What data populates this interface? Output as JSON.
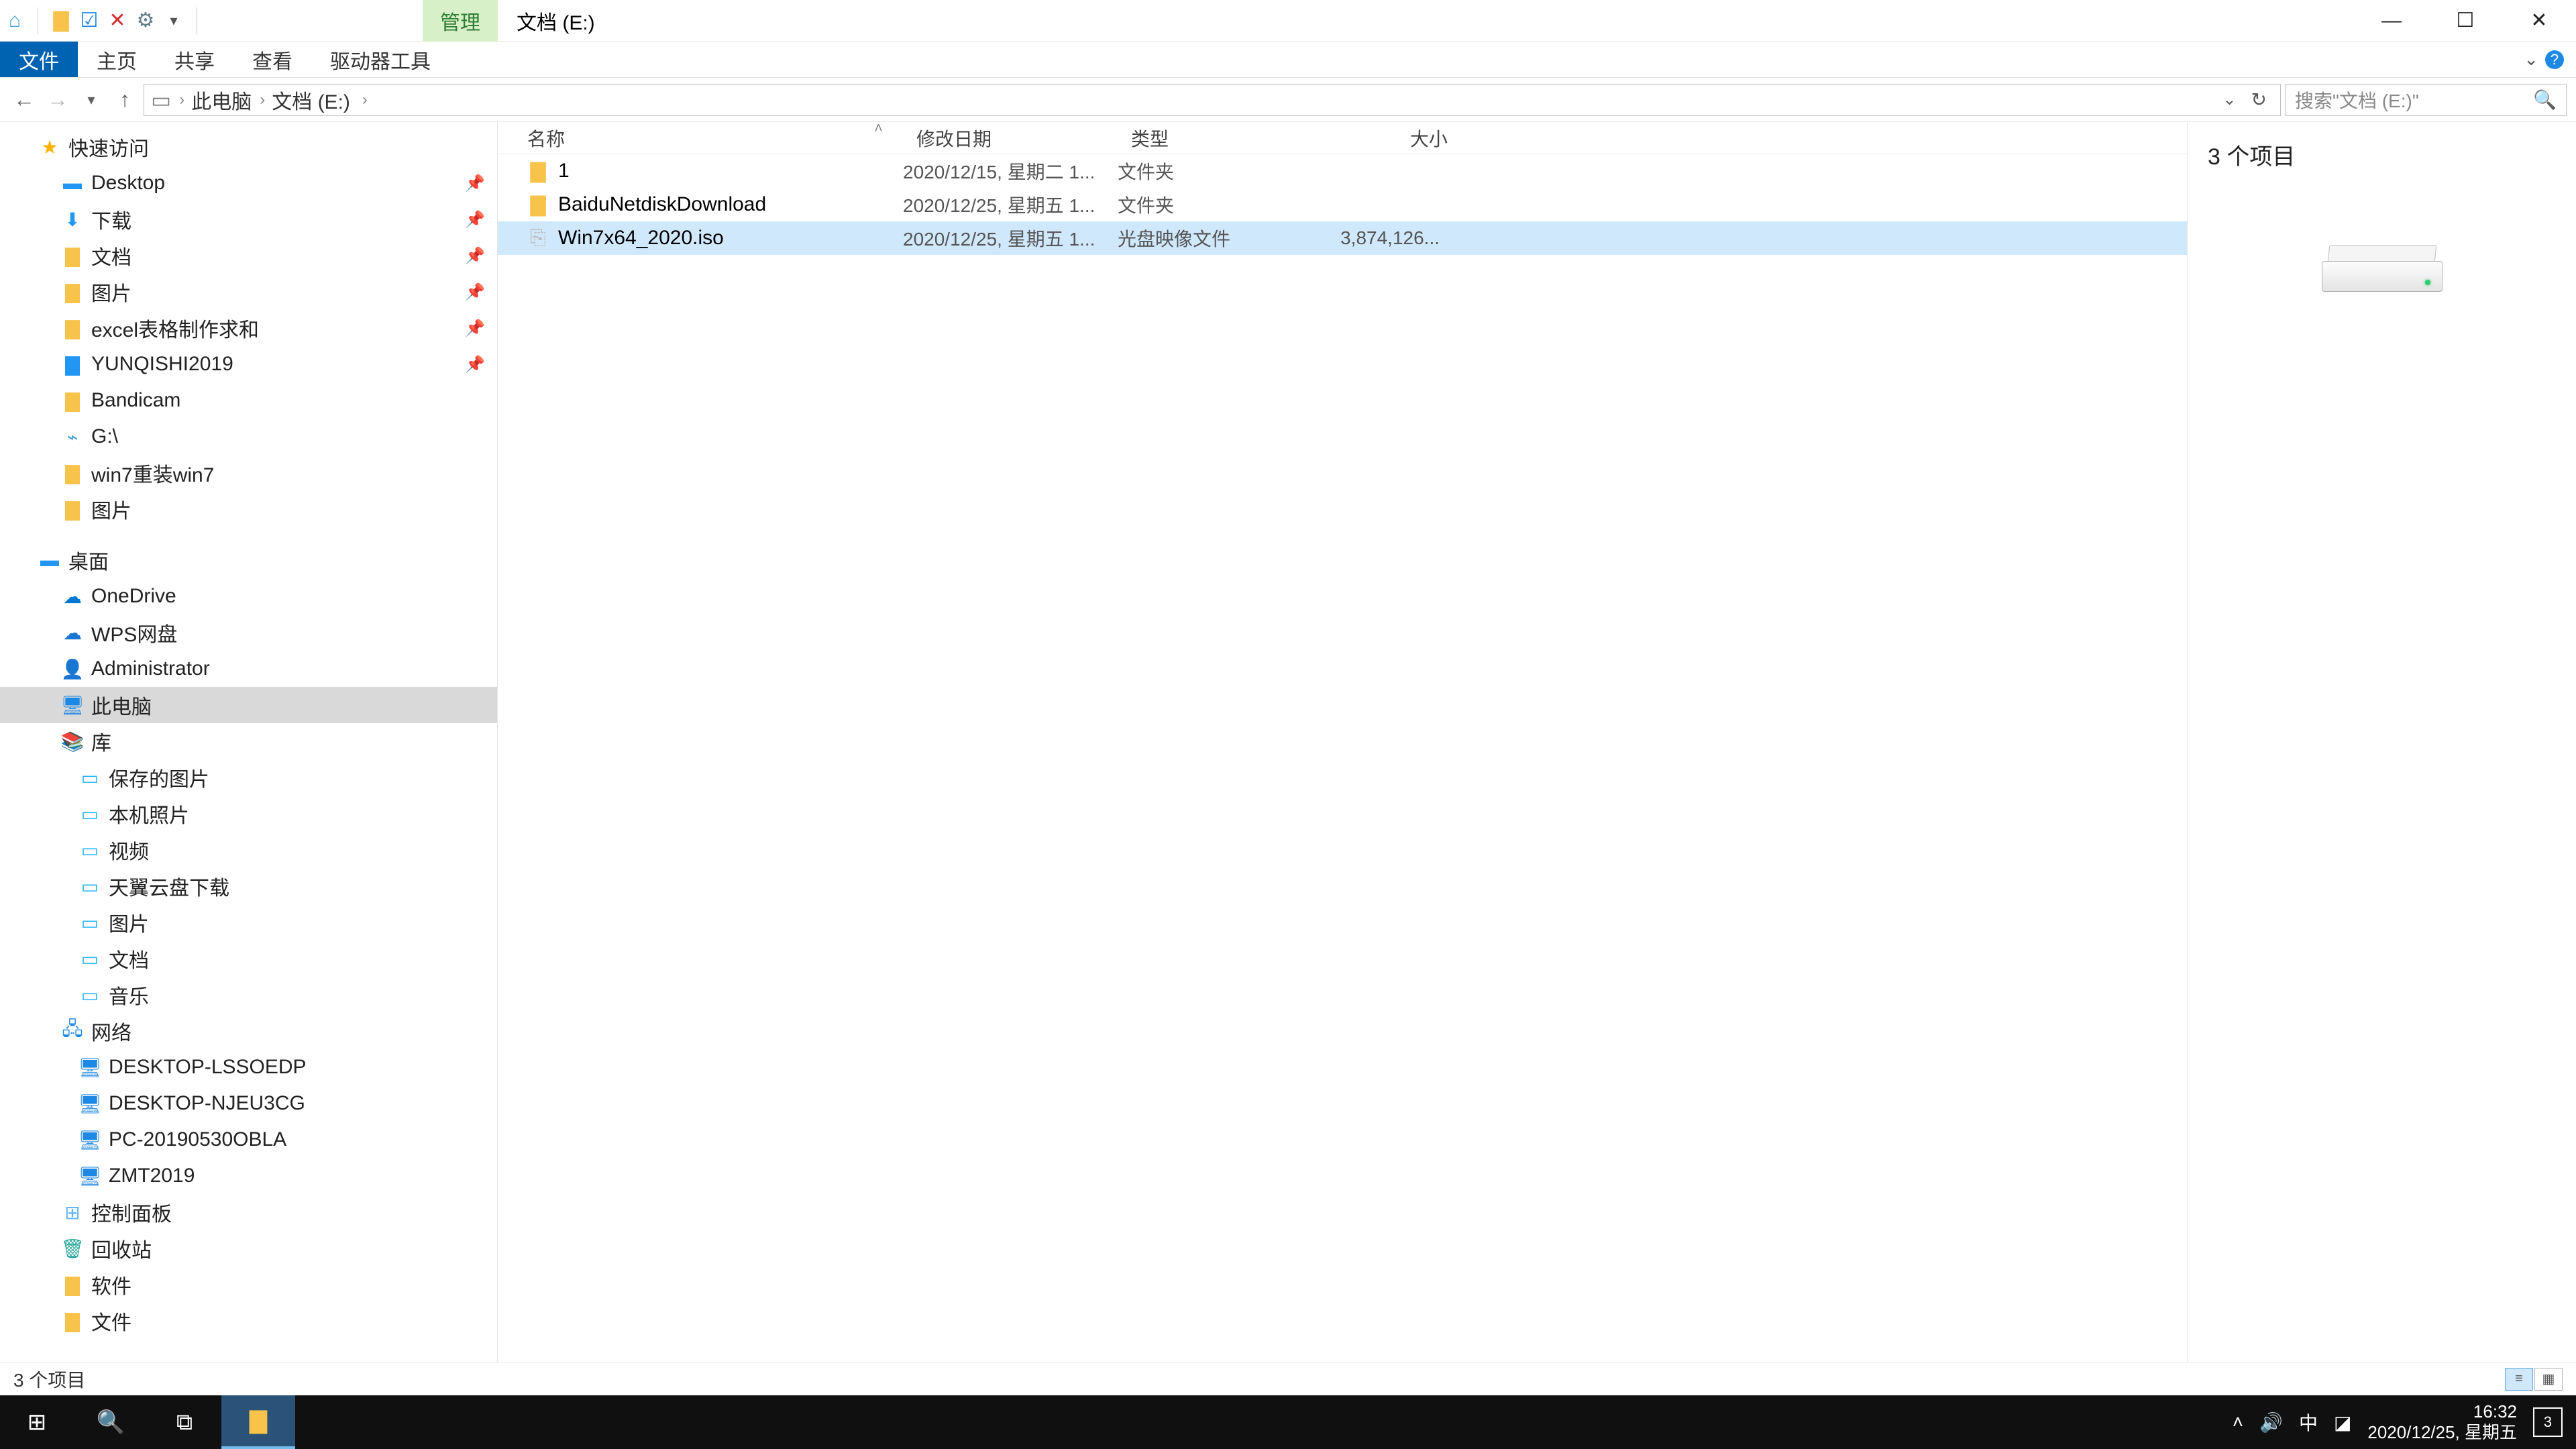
{
  "titlebar": {
    "manage_tab": "管理",
    "title": "文档 (E:)"
  },
  "ribbon": {
    "file": "文件",
    "home": "主页",
    "share": "共享",
    "view": "查看",
    "drive_tools": "驱动器工具"
  },
  "breadcrumb": {
    "root": "此电脑",
    "current": "文档 (E:)"
  },
  "search": {
    "placeholder": "搜索\"文档 (E:)\""
  },
  "nav": {
    "quick_access": "快速访问",
    "desktop_qa": "Desktop",
    "downloads": "下载",
    "documents": "文档",
    "pictures_qa": "图片",
    "excel": "excel表格制作求和",
    "yunqishi": "YUNQISHI2019",
    "bandicam": "Bandicam",
    "gdrive": "G:\\",
    "win7reinstall": "win7重装win7",
    "pictures2": "图片",
    "desktop_group": "桌面",
    "onedrive": "OneDrive",
    "wps": "WPS网盘",
    "admin": "Administrator",
    "thispc": "此电脑",
    "libraries": "库",
    "savedpics": "保存的图片",
    "cameraroll": "本机照片",
    "videos": "视频",
    "tianyi": "天翼云盘下载",
    "pictures_lib": "图片",
    "documents_lib": "文档",
    "music": "音乐",
    "network": "网络",
    "net1": "DESKTOP-LSSOEDP",
    "net2": "DESKTOP-NJEU3CG",
    "net3": "PC-20190530OBLA",
    "net4": "ZMT2019",
    "controlpanel": "控制面板",
    "recycle": "回收站",
    "software": "软件",
    "files_folder": "文件"
  },
  "columns": {
    "name": "名称",
    "date": "修改日期",
    "type": "类型",
    "size": "大小"
  },
  "rows": [
    {
      "name": "1",
      "date": "2020/12/15, 星期二 1...",
      "type": "文件夹",
      "size": "",
      "icon": "folder",
      "selected": false
    },
    {
      "name": "BaiduNetdiskDownload",
      "date": "2020/12/25, 星期五 1...",
      "type": "文件夹",
      "size": "",
      "icon": "folder",
      "selected": false
    },
    {
      "name": "Win7x64_2020.iso",
      "date": "2020/12/25, 星期五 1...",
      "type": "光盘映像文件",
      "size": "3,874,126...",
      "icon": "iso",
      "selected": true
    }
  ],
  "preview": {
    "title": "3 个项目"
  },
  "status": {
    "text": "3 个项目"
  },
  "taskbar": {
    "time": "16:32",
    "date": "2020/12/25, 星期五",
    "ime": "中",
    "notif_count": "3"
  }
}
